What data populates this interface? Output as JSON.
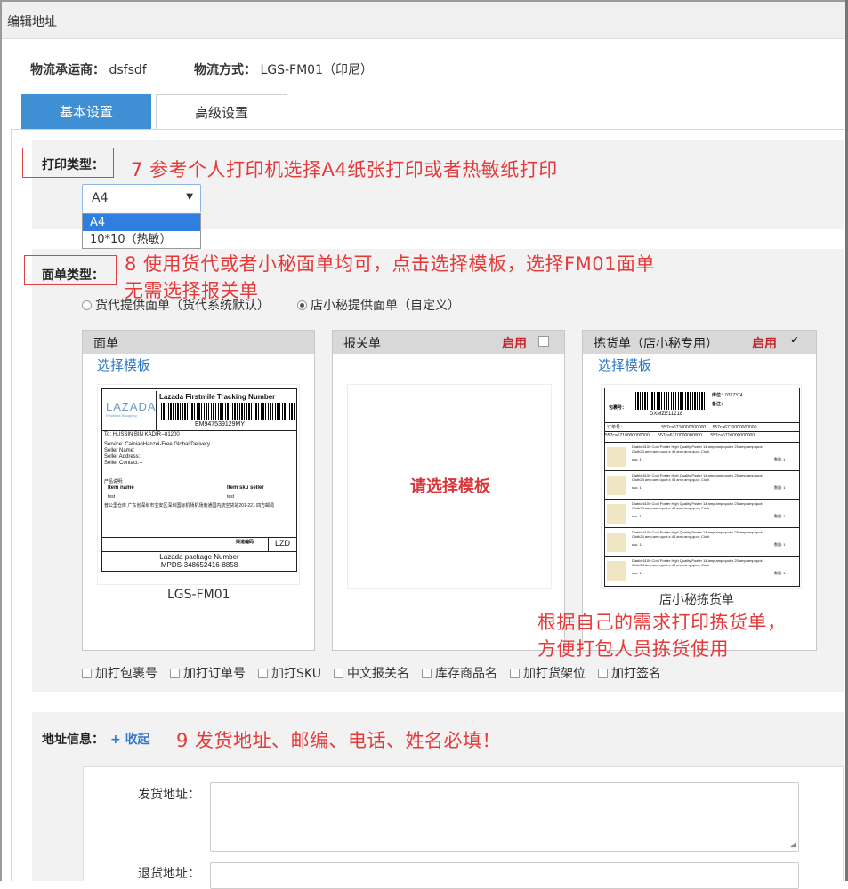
{
  "window": {
    "title": "编辑地址"
  },
  "logistics": {
    "carrier_label": "物流承运商：",
    "carrier_value": "dsfsdf",
    "method_label": "物流方式：",
    "method_value": "LGS-FM01（印尼）"
  },
  "tabs": [
    {
      "label": "基本设置",
      "active": true
    },
    {
      "label": "高级设置",
      "active": false
    }
  ],
  "print_type": {
    "label": "打印类型：",
    "selected": "A4",
    "options": [
      "A4",
      "10*10（热敏）"
    ],
    "annotation": "7 参考个人打印机选择A4纸张打印或者热敏纸打印"
  },
  "sheet_type": {
    "label": "面单类型：",
    "annotation_line1": "8 使用货代或者小秘面单均可，点击选择模板，选择FM01面单",
    "annotation_line2": "无需选择报关单",
    "radios": [
      {
        "label": "货代提供面单（货代系统默认）",
        "checked": false
      },
      {
        "label": "店小秘提供面单（自定义）",
        "checked": true
      }
    ]
  },
  "templates": {
    "waybill": {
      "header": "面单",
      "choose_link": "选择模板",
      "caption": "LGS-FM01",
      "preview": {
        "brand": "LAZADA",
        "brand_sub": "Effortless Shopping",
        "title": "Lazada Firstmile Tracking Number",
        "tracking": "EM947539129MY",
        "to": "To: HUSSIN BIN KADIR--81200",
        "service": "Service: CainiaoHanzel-Free Global Delivery",
        "seller_name": "Seller Name:",
        "seller_address": "Seller Address:",
        "seller_contact": "Seller Contact:--",
        "product_head": "产品说明:",
        "col_item": "Item name",
        "col_sku": "Item sku seller",
        "row_item": "test",
        "row_sku": "test",
        "warehouse": "普公里仓库 广东省深圳市宝安区深圳国际机场机场南通国内航空货站201-221 四方邮局",
        "code_label": "渠道编码",
        "code_value": "LZD",
        "package_line1": "Lazada package Number",
        "package_line2": "MPDS-348652416-8858"
      }
    },
    "customs": {
      "header": "报关单",
      "enable_label": "启用",
      "enabled": false,
      "placeholder": "请选择模板"
    },
    "picking": {
      "header": "拣货单（店小秘专用）",
      "enable_label": "启用",
      "enabled": true,
      "check_glyph": "✔",
      "choose_link": "选择模板",
      "caption": "店小秘拣货单",
      "preview": {
        "order_label": "包裹号：",
        "order_code": "DXMZE11218",
        "stock_label": "库位：",
        "stock_value": "0327374",
        "remark_label": "备注：",
        "col_a": "订单号：",
        "col_b": "557ca6710000000000",
        "col_c": "557ca6710000000000",
        "row_text": "Diablo 6100 Cool Poster High Quality Poster 14 amp;amp;quot;x 25 amp;amp;quot; Cloth24 amp;amp;quot;x 43 amp;amp;quot; Cloth",
        "sku_line": "sku: 1",
        "qty_line": "数量: 1"
      }
    },
    "annotation_line1": "根据自己的需求打印拣货单，",
    "annotation_line2": "方便打包人员拣货使用"
  },
  "print_options": [
    "加打包裹号",
    "加打订单号",
    "加打SKU",
    "中文报关名",
    "库存商品名",
    "加打货架位",
    "加打签名"
  ],
  "address": {
    "label": "地址信息：",
    "collapse_link": "+ 收起",
    "annotation": "9 发货地址、邮编、电话、姓名必填！",
    "ship_label": "发货地址：",
    "return_label": "退货地址："
  }
}
